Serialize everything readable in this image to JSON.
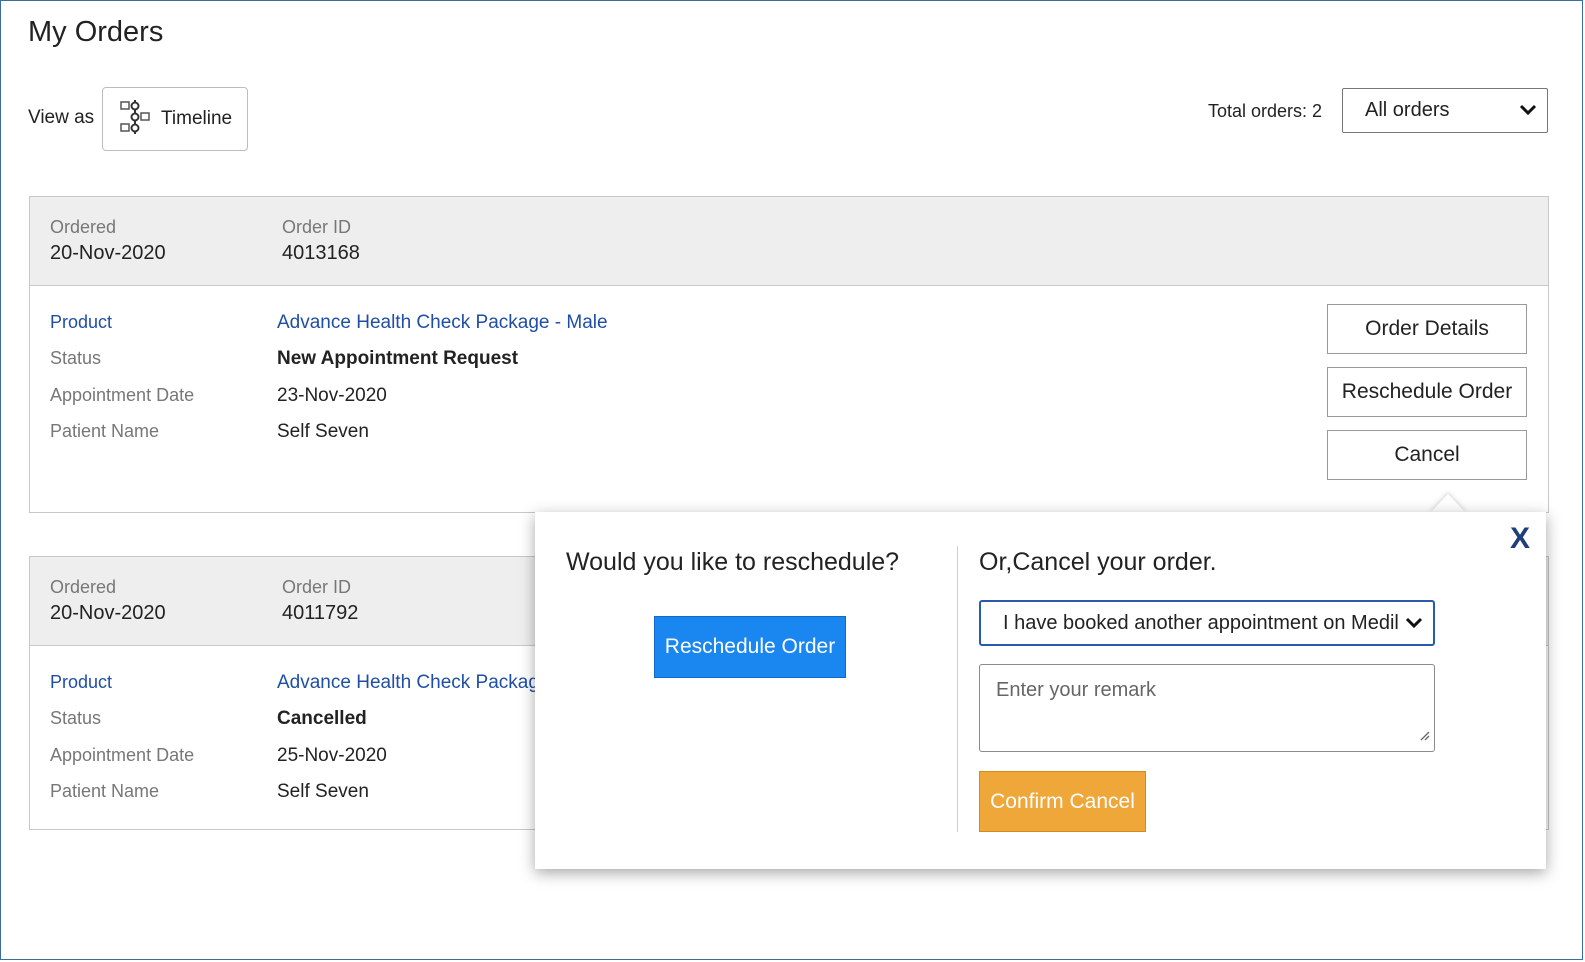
{
  "page": {
    "title": "My Orders"
  },
  "toolbar": {
    "view_as_label": "View as",
    "timeline_label": "Timeline",
    "total_orders": "Total orders: 2",
    "filter_selected": "All orders"
  },
  "orders": [
    {
      "ordered_label": "Ordered",
      "ordered_value": "20-Nov-2020",
      "order_id_label": "Order ID",
      "order_id_value": "4013168",
      "product_label": "Product",
      "product_value": "Advance Health Check Package - Male",
      "status_label": "Status",
      "status_value": "New Appointment Request",
      "appt_label": "Appointment Date",
      "appt_value": "23-Nov-2020",
      "patient_label": "Patient Name",
      "patient_value": "Self Seven",
      "actions": {
        "details": "Order Details",
        "reschedule": "Reschedule Order",
        "cancel": "Cancel"
      }
    },
    {
      "ordered_label": "Ordered",
      "ordered_value": "20-Nov-2020",
      "order_id_label": "Order ID",
      "order_id_value": "4011792",
      "product_label": "Product",
      "product_value": "Advance Health Check Package",
      "status_label": "Status",
      "status_value": "Cancelled",
      "appt_label": "Appointment Date",
      "appt_value": "25-Nov-2020",
      "patient_label": "Patient Name",
      "patient_value": "Self Seven"
    }
  ],
  "popup": {
    "reschedule_heading": "Would you like to reschedule?",
    "reschedule_button": "Reschedule Order",
    "cancel_heading": "Or,Cancel your order.",
    "reason_selected": "I have booked another appointment on Medil",
    "remark_placeholder": "Enter your remark",
    "confirm_button": "Confirm Cancel",
    "close_glyph": "X"
  },
  "colors": {
    "link": "#1f4fa5",
    "primary": "#1a86f0",
    "warning": "#f0a73a"
  }
}
